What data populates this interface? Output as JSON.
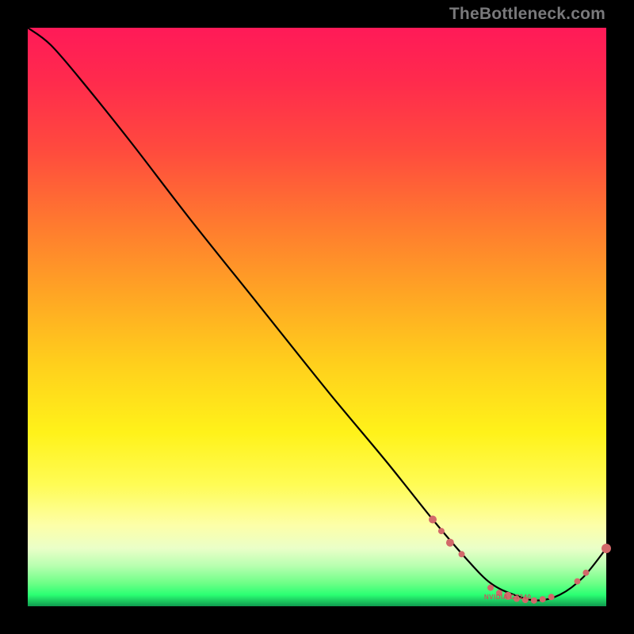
{
  "watermark": "TheBottleneck.com",
  "micro_label": "NVIDIA GT240",
  "chart_data": {
    "type": "line",
    "title": "",
    "xlabel": "",
    "ylabel": "",
    "xlim": [
      0,
      100
    ],
    "ylim": [
      0,
      100
    ],
    "grid": false,
    "legend": false,
    "series": [
      {
        "name": "bottleneck-curve",
        "x": [
          0,
          4,
          10,
          18,
          28,
          40,
          52,
          62,
          70,
          76,
          80,
          84,
          88,
          92,
          96,
          100
        ],
        "y": [
          100,
          97,
          90,
          80,
          67,
          52,
          37,
          25,
          15,
          8,
          4,
          2,
          1,
          2,
          5,
          10
        ]
      }
    ],
    "markers": [
      {
        "x": 70,
        "y": 15,
        "r": 5
      },
      {
        "x": 71.5,
        "y": 13,
        "r": 4
      },
      {
        "x": 73,
        "y": 11,
        "r": 5
      },
      {
        "x": 75,
        "y": 9,
        "r": 4
      },
      {
        "x": 80,
        "y": 3.2,
        "r": 4
      },
      {
        "x": 81.5,
        "y": 2.3,
        "r": 4
      },
      {
        "x": 83,
        "y": 1.8,
        "r": 5
      },
      {
        "x": 84.5,
        "y": 1.3,
        "r": 4
      },
      {
        "x": 86,
        "y": 1.1,
        "r": 4
      },
      {
        "x": 87.5,
        "y": 1.0,
        "r": 4
      },
      {
        "x": 89,
        "y": 1.2,
        "r": 4
      },
      {
        "x": 90.5,
        "y": 1.6,
        "r": 4
      },
      {
        "x": 95,
        "y": 4.3,
        "r": 4
      },
      {
        "x": 96.5,
        "y": 5.8,
        "r": 4
      },
      {
        "x": 100,
        "y": 10,
        "r": 6
      }
    ]
  }
}
